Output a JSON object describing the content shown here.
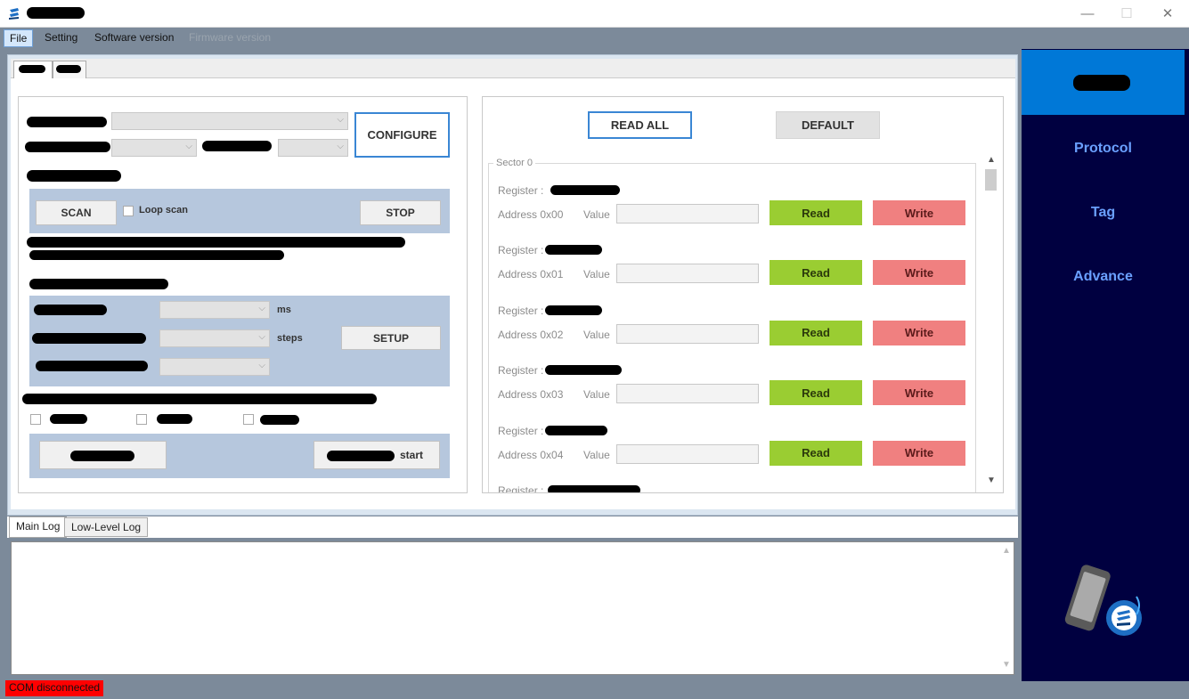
{
  "window": {
    "minimize": "—",
    "maximize": "☐",
    "close": "✕"
  },
  "menu": {
    "file": "File",
    "setting": "Setting",
    "software_version": "Software version",
    "firmware_version": "Firmware version"
  },
  "left": {
    "configure": "CONFIGURE",
    "scan": "SCAN",
    "loop_scan": "Loop scan",
    "stop": "STOP",
    "ms": "ms",
    "steps": "steps",
    "setup": "SETUP",
    "start_suffix": "start"
  },
  "right": {
    "read_all": "READ ALL",
    "default": "DEFAULT",
    "sector": "Sector 0",
    "register_label": "Register :",
    "value_label": "Value",
    "read": "Read",
    "write": "Write",
    "registers": [
      {
        "address": "Address 0x00"
      },
      {
        "address": "Address 0x01"
      },
      {
        "address": "Address 0x02"
      },
      {
        "address": "Address 0x03"
      },
      {
        "address": "Address 0x04"
      }
    ]
  },
  "sidebar": {
    "protocol": "Protocol",
    "tag": "Tag",
    "advance": "Advance"
  },
  "log": {
    "main_log": "Main Log",
    "low_level_log": "Low-Level Log"
  },
  "status": {
    "com": "COM disconnected"
  },
  "colors": {
    "read": "#9acd32",
    "write": "#f08080",
    "sidebar": "#000040",
    "sidebar_active": "#0078d7",
    "status_error": "#ff0000"
  }
}
